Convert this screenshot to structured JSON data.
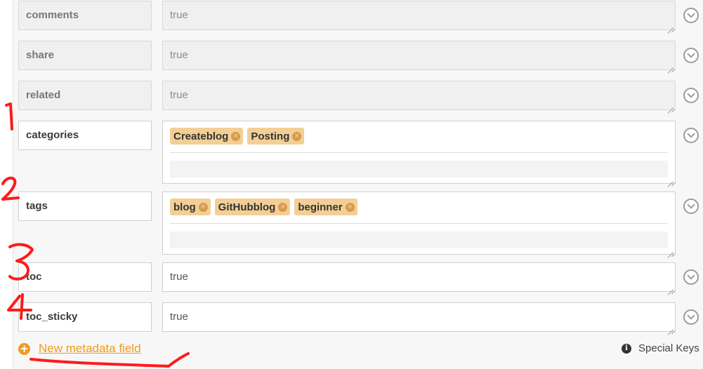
{
  "fields": [
    {
      "key": "comments",
      "value": "true",
      "disabled": true
    },
    {
      "key": "share",
      "value": "true",
      "disabled": true
    },
    {
      "key": "related",
      "value": "true",
      "disabled": true
    },
    {
      "key": "categories",
      "tags": [
        "Createblog",
        "Posting"
      ]
    },
    {
      "key": "tags",
      "tags": [
        "blog",
        "GitHubblog",
        "beginner"
      ]
    },
    {
      "key": "toc",
      "value": "true"
    },
    {
      "key": "toc_sticky",
      "value": "true"
    }
  ],
  "footer": {
    "add_label": "New metadata field",
    "special_keys_label": "Special Keys"
  },
  "icons": {
    "expand": "chevron-down-icon",
    "remove_tag": "close-circle-icon",
    "add": "plus-circle-icon",
    "info": "info-icon"
  },
  "colors": {
    "tag_bg": "#f3cf96",
    "tag_remove": "#d69a4d",
    "accent": "#f09b1d",
    "annotation": "#ff1a1a"
  }
}
